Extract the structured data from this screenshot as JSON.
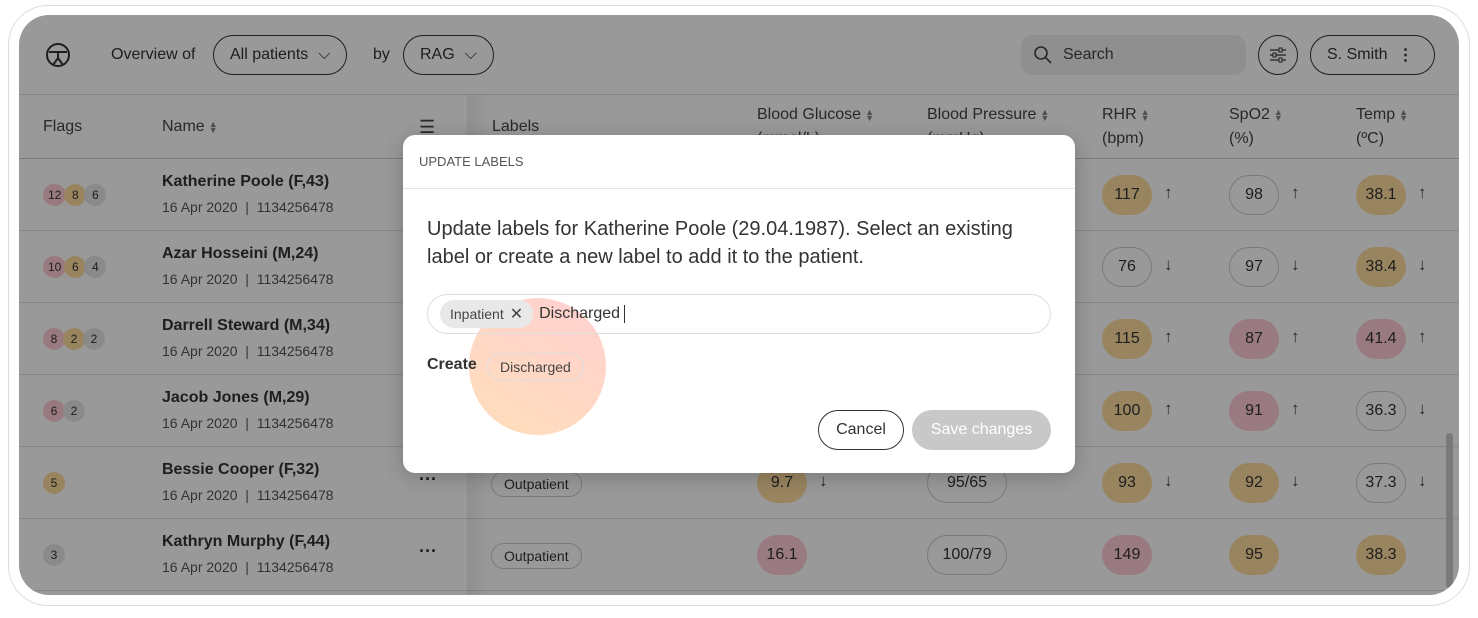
{
  "header": {
    "overview_label": "Overview of",
    "patients_select": "All patients",
    "by_label": "by",
    "group_select": "RAG",
    "search_placeholder": "Search",
    "user": "S. Smith"
  },
  "columns": {
    "flags": "Flags",
    "name": "Name",
    "labels": "Labels",
    "glucose": "Blood Glucose",
    "glucose_unit": "(mmol/L)",
    "bp": "Blood Pressure",
    "bp_unit": "(mmHg)",
    "rhr": "RHR",
    "rhr_unit": "(bpm)",
    "spo2": "SpO2",
    "spo2_unit": "(%)",
    "temp": "Temp",
    "temp_unit": "(ºC)"
  },
  "colors": {
    "red": "#ffcbd5",
    "amber": "#ffdca0",
    "gray": "#e6e6e6"
  },
  "rows": [
    {
      "flags": [
        [
          "12",
          "pink"
        ],
        [
          "8",
          "amber"
        ],
        [
          "6",
          "gray"
        ]
      ],
      "name": "Katherine Poole (F,43)",
      "date": "16 Apr 2020",
      "id": "1134256478",
      "rhr": [
        "117",
        "amber",
        "↑"
      ],
      "spo2": [
        "98",
        "neutral",
        "↑"
      ],
      "temp": [
        "38.1",
        "amber",
        "↑"
      ]
    },
    {
      "flags": [
        [
          "10",
          "pink"
        ],
        [
          "6",
          "amber"
        ],
        [
          "4",
          "gray"
        ]
      ],
      "name": "Azar Hosseini (M,24)",
      "date": "16 Apr 2020",
      "id": "1134256478",
      "rhr": [
        "76",
        "neutral",
        "↓"
      ],
      "spo2": [
        "97",
        "neutral",
        "↓"
      ],
      "temp": [
        "38.4",
        "amber",
        "↓"
      ]
    },
    {
      "flags": [
        [
          "8",
          "pink"
        ],
        [
          "2",
          "amber"
        ],
        [
          "2",
          "gray"
        ]
      ],
      "name": "Darrell Steward (M,34)",
      "date": "16 Apr 2020",
      "id": "1134256478",
      "rhr": [
        "115",
        "amber",
        "↑"
      ],
      "spo2": [
        "87",
        "pink",
        "↑"
      ],
      "temp": [
        "41.4",
        "pink",
        "↑"
      ]
    },
    {
      "flags": [
        [
          "6",
          "pink"
        ],
        [
          "2",
          "gray"
        ]
      ],
      "name": "Jacob Jones (M,29)",
      "date": "16 Apr 2020",
      "id": "1134256478",
      "rhr": [
        "100",
        "amber",
        "↑"
      ],
      "spo2": [
        "91",
        "pink",
        "↑"
      ],
      "temp": [
        "36.3",
        "neutral",
        "↓"
      ]
    },
    {
      "flags": [
        [
          "5",
          "amber"
        ]
      ],
      "name": "Bessie Cooper (F,32)",
      "date": "16 Apr 2020",
      "id": "1134256478",
      "label": "Outpatient",
      "glucose": [
        "9.7",
        "amber",
        "↓"
      ],
      "bp": [
        "95/65",
        "neutral",
        ""
      ],
      "rhr": [
        "93",
        "amber",
        "↓"
      ],
      "spo2": [
        "92",
        "amber",
        "↓"
      ],
      "temp": [
        "37.3",
        "neutral",
        "↓"
      ]
    },
    {
      "flags": [
        [
          "3",
          "gray"
        ]
      ],
      "name": "Kathryn Murphy (F,44)",
      "date": "16 Apr 2020",
      "id": "1134256478",
      "label": "Outpatient",
      "glucose": [
        "16.1",
        "pink",
        ""
      ],
      "bp": [
        "100/79",
        "neutral",
        ""
      ],
      "rhr": [
        "149",
        "pink",
        ""
      ],
      "spo2": [
        "95",
        "amber",
        ""
      ],
      "temp": [
        "38.3",
        "amber",
        ""
      ]
    }
  ],
  "modal": {
    "title": "UPDATE LABELS",
    "description": "Update labels for Katherine Poole (29.04.1987). Select an existing label or create a new label to add it to the patient.",
    "chip": "Inpatient",
    "input_value": "Discharged",
    "create_label": "Create",
    "create_chip": "Discharged",
    "cancel": "Cancel",
    "save": "Save changes",
    "save_enabled": false
  }
}
